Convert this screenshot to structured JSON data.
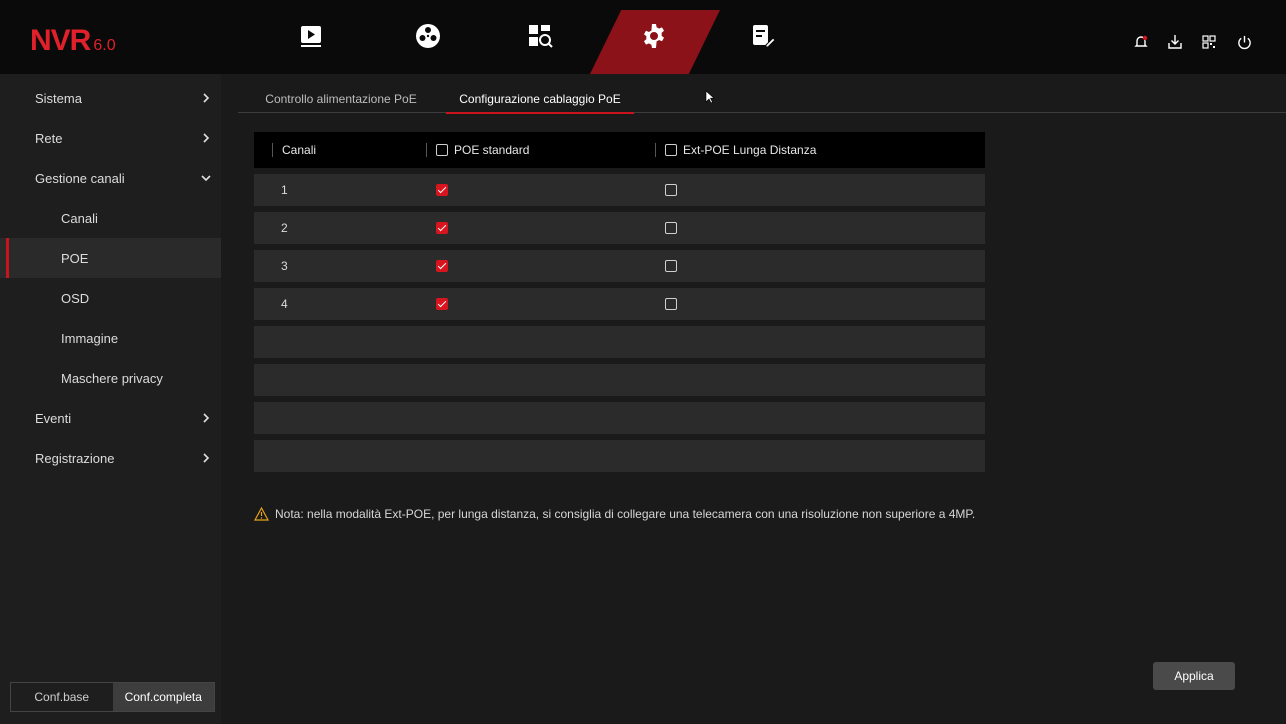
{
  "app": {
    "logo_main": "NVR",
    "logo_version": "6.0",
    "accent_color": "#c8141c"
  },
  "topnav": {
    "items": [
      {
        "name": "playback-icon"
      },
      {
        "name": "film-reel-icon"
      },
      {
        "name": "search-grid-icon"
      },
      {
        "name": "gear-icon",
        "active": true
      },
      {
        "name": "maintenance-icon"
      }
    ],
    "right_icons": [
      "alarm-icon",
      "download-icon",
      "qr-code-icon",
      "power-icon"
    ]
  },
  "sidebar": {
    "items": [
      {
        "label": "Sistema",
        "chevron": "right"
      },
      {
        "label": "Rete",
        "chevron": "right"
      },
      {
        "label": "Gestione canali",
        "chevron": "down"
      },
      {
        "label": "Canali"
      },
      {
        "label": "POE",
        "active": true
      },
      {
        "label": "OSD"
      },
      {
        "label": "Immagine"
      },
      {
        "label": "Maschere privacy"
      },
      {
        "label": "Eventi",
        "chevron": "right"
      },
      {
        "label": "Registrazione",
        "chevron": "right"
      }
    ],
    "conf_base": "Conf.base",
    "conf_full": "Conf.completa"
  },
  "tabs": [
    {
      "label": "Controllo alimentazione PoE"
    },
    {
      "label": "Configurazione cablaggio PoE",
      "active": true
    }
  ],
  "table": {
    "headers": {
      "channels": "Canali",
      "poe_standard": "POE standard",
      "ext_poe": "Ext-POE Lunga Distanza"
    },
    "rows": [
      {
        "channel": "1",
        "poe_standard": true,
        "ext_poe": false
      },
      {
        "channel": "2",
        "poe_standard": true,
        "ext_poe": false
      },
      {
        "channel": "3",
        "poe_standard": true,
        "ext_poe": false
      },
      {
        "channel": "4",
        "poe_standard": true,
        "ext_poe": false
      },
      {
        "channel": "",
        "empty": true
      },
      {
        "channel": "",
        "empty": true
      },
      {
        "channel": "",
        "empty": true
      },
      {
        "channel": "",
        "empty": true
      }
    ]
  },
  "note": "Nota: nella modalità Ext-POE, per lunga distanza, si consiglia di collegare una telecamera con una risoluzione non superiore a 4MP.",
  "apply_label": "Applica"
}
